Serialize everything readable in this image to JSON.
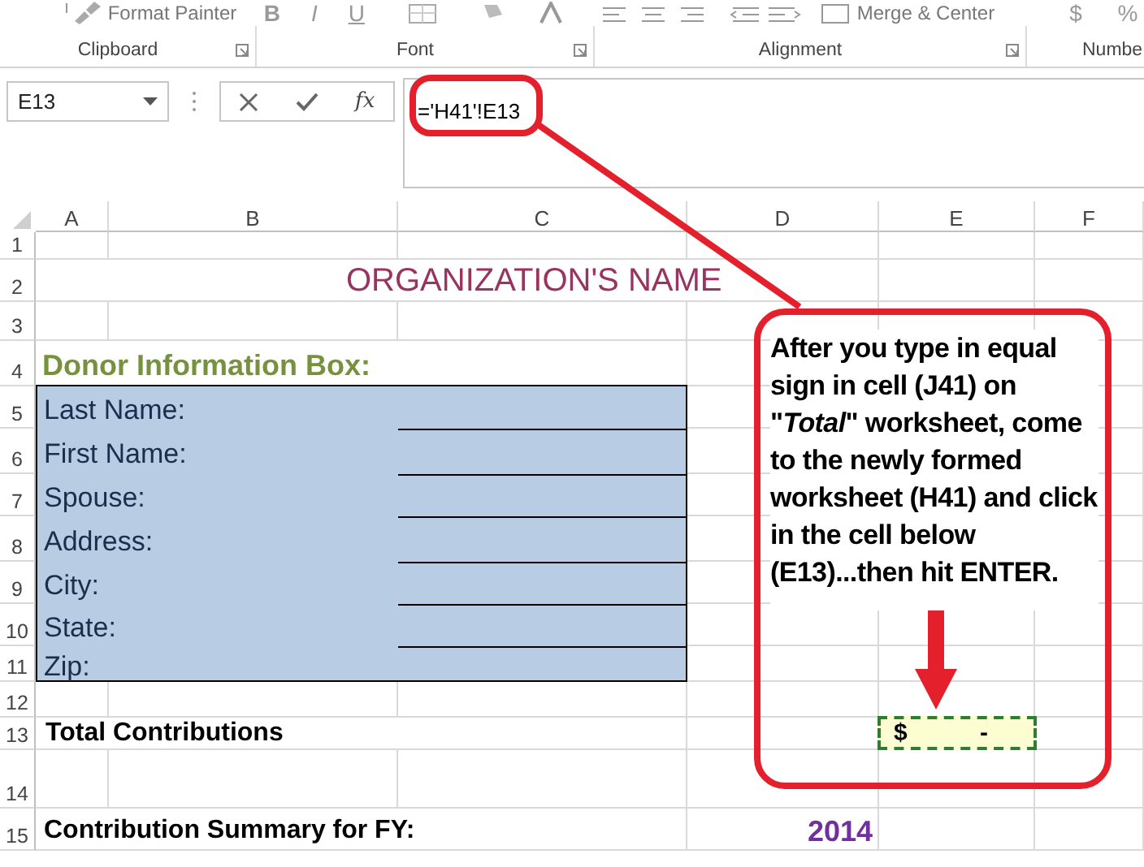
{
  "ribbon": {
    "format_painter": "Format Painter",
    "font_buttons": [
      "B",
      "I",
      "U"
    ],
    "merge_center": "Merge & Center",
    "number_buttons": [
      "$",
      "%"
    ],
    "groups": [
      {
        "label": "Clipboard"
      },
      {
        "label": "Font"
      },
      {
        "label": "Alignment"
      },
      {
        "label": "Numbe"
      }
    ]
  },
  "formula_bar": {
    "name_box": "E13",
    "function_button": "fx",
    "formula": "='H41'!E13"
  },
  "columns": [
    "A",
    "B",
    "C",
    "D",
    "E",
    "F"
  ],
  "rows": [
    "1",
    "2",
    "3",
    "4",
    "5",
    "6",
    "7",
    "8",
    "9",
    "10",
    "11",
    "12",
    "13",
    "14",
    "15"
  ],
  "title": "ORGANIZATION'S NAME",
  "donor_box": {
    "heading": "Donor Information Box:",
    "fields": [
      {
        "label": "Last Name:",
        "has_line": true
      },
      {
        "label": "First Name:",
        "has_line": true
      },
      {
        "label": "Spouse:",
        "has_line": true
      },
      {
        "label": "Address:",
        "has_line": true
      },
      {
        "label": "City:",
        "has_line": true
      },
      {
        "label": "State:",
        "has_line": true
      },
      {
        "label": "Zip:",
        "has_line": false
      }
    ]
  },
  "total": {
    "label": "Total Contributions",
    "currency": "$",
    "value": "-",
    "selected": true
  },
  "summary": {
    "label": "Contribution Summary for FY:",
    "year": "2014"
  },
  "callout": {
    "text": "After you type in equal sign in cell (J41) on \"*Total*\" worksheet, come to the newly formed worksheet (H41) and click in the cell below (E13)...then hit ENTER."
  }
}
